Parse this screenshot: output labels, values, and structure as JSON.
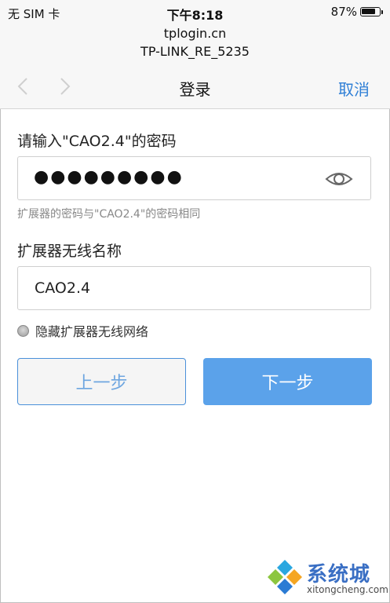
{
  "status_bar": {
    "carrier": "无 SIM 卡",
    "time": "下午8:18",
    "battery_pct": "87%",
    "battery_level": 0.87
  },
  "url_bar": {
    "host": "tplogin.cn",
    "title": "TP-LINK_RE_5235"
  },
  "nav": {
    "title": "登录",
    "cancel": "取消",
    "icons": [
      "chevron-left-icon",
      "chevron-right-icon"
    ]
  },
  "form": {
    "password_label": "请输入\"CAO2.4\"的密码",
    "password_value": "●●●●●●●●●",
    "password_hint": "扩展器的密码与\"CAO2.4\"的密码相同",
    "ssid_label": "扩展器无线名称",
    "ssid_value": "CAO2.4",
    "hide_network_label": "隐藏扩展器无线网络"
  },
  "buttons": {
    "prev": "上一步",
    "next": "下一步"
  },
  "watermark": {
    "name": "系统城",
    "url": "xitongcheng.com"
  },
  "colors": {
    "accent": "#2f7fd6",
    "primary_button": "#5ba2ea",
    "secondary_border": "#4a90d9"
  }
}
